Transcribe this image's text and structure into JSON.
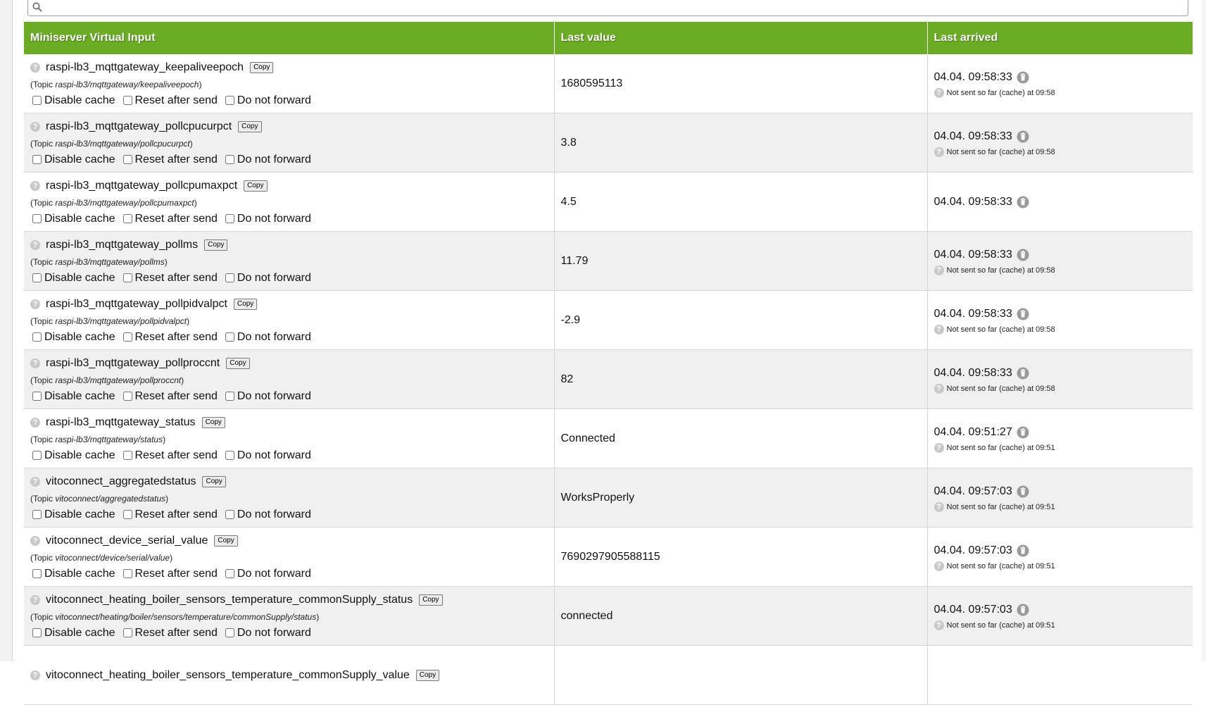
{
  "search": {
    "value": "",
    "placeholder": ""
  },
  "table": {
    "headers": [
      "Miniserver Virtual Input",
      "Last value",
      "Last arrived"
    ],
    "copy_label": "Copy",
    "options": [
      "Disable cache",
      "Reset after send",
      "Do not forward"
    ],
    "rows": [
      {
        "name": "raspi-lb3_mqttgateway_keepaliveepoch",
        "topic_prefix": "(Topic ",
        "topic": "raspi-lb3/mqttgateway/keepaliveepoch",
        "topic_suffix": ")",
        "value": "1680595113",
        "arrived": "04.04. 09:58:33",
        "status": "Not sent so far (cache) at 09:58"
      },
      {
        "name": "raspi-lb3_mqttgateway_pollcpucurpct",
        "topic_prefix": "(Topic ",
        "topic": "raspi-lb3/mqttgateway/pollcpucurpct",
        "topic_suffix": ")",
        "value": "3.8",
        "arrived": "04.04. 09:58:33",
        "status": "Not sent so far (cache) at 09:58"
      },
      {
        "name": "raspi-lb3_mqttgateway_pollcpumaxpct",
        "topic_prefix": "(Topic ",
        "topic": "raspi-lb3/mqttgateway/pollcpumaxpct",
        "topic_suffix": ")",
        "value": "4.5",
        "arrived": "04.04. 09:58:33",
        "status": ""
      },
      {
        "name": "raspi-lb3_mqttgateway_pollms",
        "topic_prefix": "(Topic ",
        "topic": "raspi-lb3/mqttgateway/pollms",
        "topic_suffix": ")",
        "value": "11.79",
        "arrived": "04.04. 09:58:33",
        "status": "Not sent so far (cache) at 09:58"
      },
      {
        "name": "raspi-lb3_mqttgateway_pollpidvalpct",
        "topic_prefix": "(Topic ",
        "topic": "raspi-lb3/mqttgateway/pollpidvalpct",
        "topic_suffix": ")",
        "value": "-2.9",
        "arrived": "04.04. 09:58:33",
        "status": "Not sent so far (cache) at 09:58"
      },
      {
        "name": "raspi-lb3_mqttgateway_pollproccnt",
        "topic_prefix": "(Topic ",
        "topic": "raspi-lb3/mqttgateway/pollproccnt",
        "topic_suffix": ")",
        "value": "82",
        "arrived": "04.04. 09:58:33",
        "status": "Not sent so far (cache) at 09:58"
      },
      {
        "name": "raspi-lb3_mqttgateway_status",
        "topic_prefix": "(Topic ",
        "topic": "raspi-lb3/mqttgateway/status",
        "topic_suffix": ")",
        "value": "Connected",
        "arrived": "04.04. 09:51:27",
        "status": "Not sent so far (cache) at 09:51"
      },
      {
        "name": "vitoconnect_aggregatedstatus",
        "topic_prefix": "(Topic ",
        "topic": "vitoconnect/aggregatedstatus",
        "topic_suffix": ")",
        "value": "WorksProperly",
        "arrived": "04.04. 09:57:03",
        "status": "Not sent so far (cache) at 09:51"
      },
      {
        "name": "vitoconnect_device_serial_value",
        "topic_prefix": "(Topic ",
        "topic": "vitoconnect/device/serial/value",
        "topic_suffix": ")",
        "value": "7690297905588115",
        "arrived": "04.04. 09:57:03",
        "status": "Not sent so far (cache) at 09:51"
      },
      {
        "name": "vitoconnect_heating_boiler_sensors_temperature_commonSupply_status",
        "topic_prefix": "(Topic ",
        "topic": "vitoconnect/heating/boiler/sensors/temperature/commonSupply/status",
        "topic_suffix": ")",
        "value": "connected",
        "arrived": "04.04. 09:57:03",
        "status": "Not sent so far (cache) at 09:51"
      },
      {
        "name": "vitoconnect_heating_boiler_sensors_temperature_commonSupply_value",
        "topic_prefix": "",
        "topic": "",
        "topic_suffix": "",
        "value": "",
        "arrived": "",
        "status": ""
      }
    ]
  }
}
